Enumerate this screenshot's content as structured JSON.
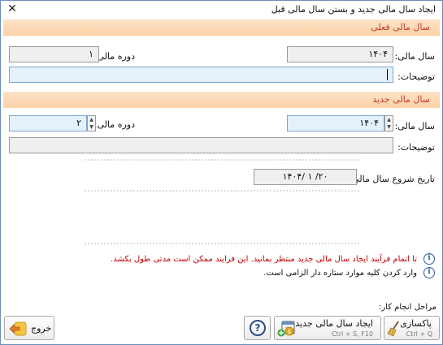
{
  "window": {
    "title": "ایجاد سال مالی جدید و بستن سال مالی قبل",
    "close_glyph": "✕"
  },
  "current_year": {
    "header": "سال مالی فعلی",
    "year_label": "سال مالی:",
    "year_value": "۱۴۰۴",
    "period_label": "دوره مالی:",
    "period_value": "۱",
    "desc_label": "توضیحات:",
    "desc_value": ""
  },
  "new_year": {
    "header": "سال مالی جدید",
    "year_label": "سال مالی:",
    "year_value": "۱۴۰۴",
    "period_label": "دوره مالی:",
    "period_value": "۲",
    "desc_label": "توضیحات:",
    "desc_value": "",
    "start_date_label": "تاریخ شروع سال مالی:",
    "start_date_value": "۱۴۰۴/ ۱ /۲۰"
  },
  "messages": [
    {
      "text": "تا اتمام فرآیند ایجاد سال مالی جدید منتظر بمانید. این فرایند ممکن است مدتی طول بکشد.",
      "color": "#c00000"
    },
    {
      "text": "وارد کردن کلیه موارد ستاره دار الزامی است.",
      "color": "#111111"
    }
  ],
  "info_glyph": "i",
  "steps_label": "مراحل انجام کار:",
  "buttons": {
    "cleanup": {
      "label": "پاکسازی",
      "shortcut": "Ctrl + Q"
    },
    "create": {
      "label": "ایجاد سال مالی جدید",
      "shortcut": "Ctrl + S, F10"
    },
    "help": {
      "glyph": "?"
    },
    "exit": {
      "label": "خروج"
    }
  },
  "spin_up": "▲",
  "spin_down": "▼",
  "colors": {
    "section_header_text": "#c0392b",
    "section_header_bg": "#fbd2a8",
    "accent_blue": "#2a5ea8"
  }
}
